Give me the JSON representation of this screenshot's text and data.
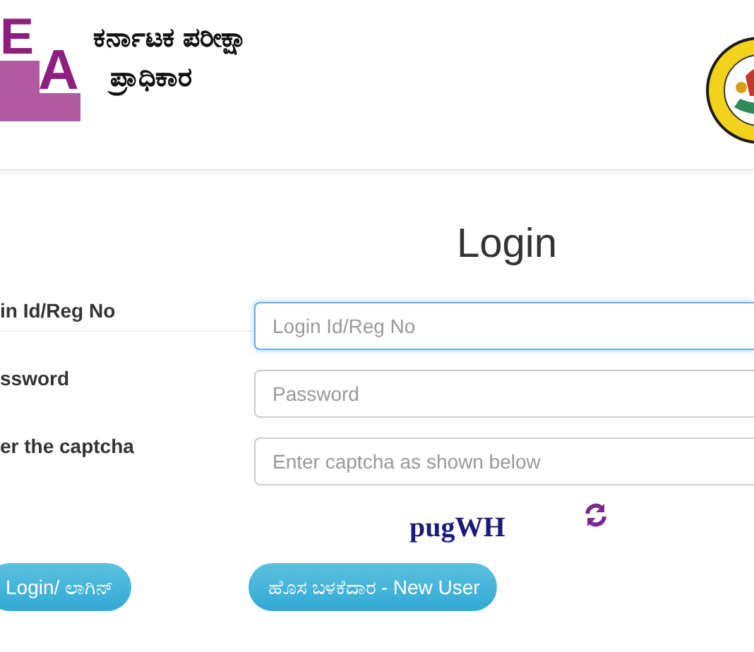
{
  "header": {
    "logo_letters": [
      "E",
      "A"
    ],
    "org_name_lines": [
      "ಕರ್ನಾಟಕ ಪರೀಕ್ಷಾ",
      "ಪ್ರಾಧಿಕಾರ"
    ]
  },
  "login": {
    "title": "Login",
    "fields": [
      {
        "label": "in Id/Reg No",
        "placeholder": "Login Id/Reg No",
        "focused": true
      },
      {
        "label": "ssword",
        "placeholder": "Password",
        "focused": false
      },
      {
        "label": "er the captcha",
        "placeholder": "Enter captcha as shown below",
        "focused": false
      }
    ],
    "captcha": "pugWH",
    "buttons": [
      "Login/ ಲಾಗಿನ್",
      "ಹೊಸ ಬಳಕೆದಾರ - New User"
    ]
  }
}
